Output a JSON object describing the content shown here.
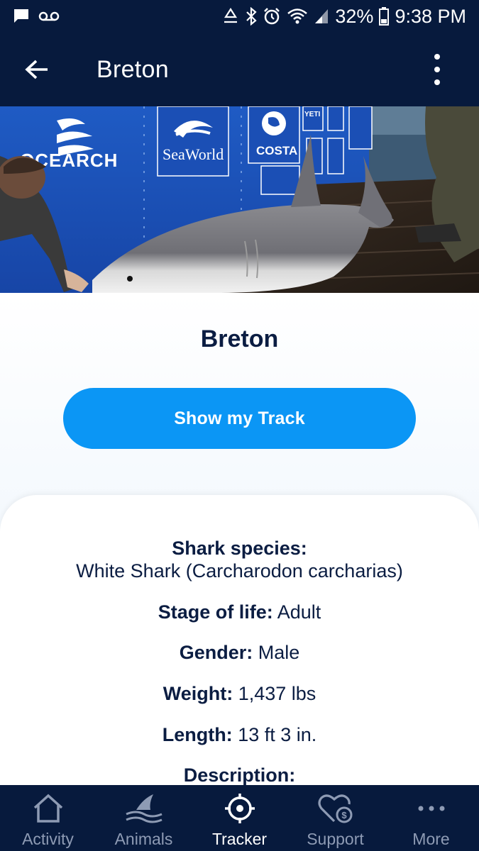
{
  "status_bar": {
    "battery": "32%",
    "time": "9:38 PM"
  },
  "app_bar": {
    "title": "Breton"
  },
  "hero": {
    "banner_logos": [
      "OCEARCH",
      "SeaWorld",
      "COSTA",
      "YETI"
    ]
  },
  "profile": {
    "name": "Breton",
    "track_button": "Show my Track",
    "species_label": "Shark species:",
    "species_value": "White Shark (Carcharodon carcharias)",
    "stage_label": "Stage of life:",
    "stage_value": "Adult",
    "gender_label": "Gender:",
    "gender_value": "Male",
    "weight_label": "Weight:",
    "weight_value": "1,437 lbs",
    "length_label": "Length:",
    "length_value": "13 ft 3 in.",
    "description_label": "Description:"
  },
  "bottom_nav": [
    {
      "label": "Activity",
      "icon": "house-icon",
      "active": false
    },
    {
      "label": "Animals",
      "icon": "shark-fin-icon",
      "active": false
    },
    {
      "label": "Tracker",
      "icon": "crosshair-icon",
      "active": true
    },
    {
      "label": "Support",
      "icon": "heart-dollar-icon",
      "active": false
    },
    {
      "label": "More",
      "icon": "more-dots-icon",
      "active": false
    }
  ],
  "colors": {
    "navy": "#071a3d",
    "accent_blue": "#0b96f5",
    "text_dark": "#0b1d42"
  }
}
